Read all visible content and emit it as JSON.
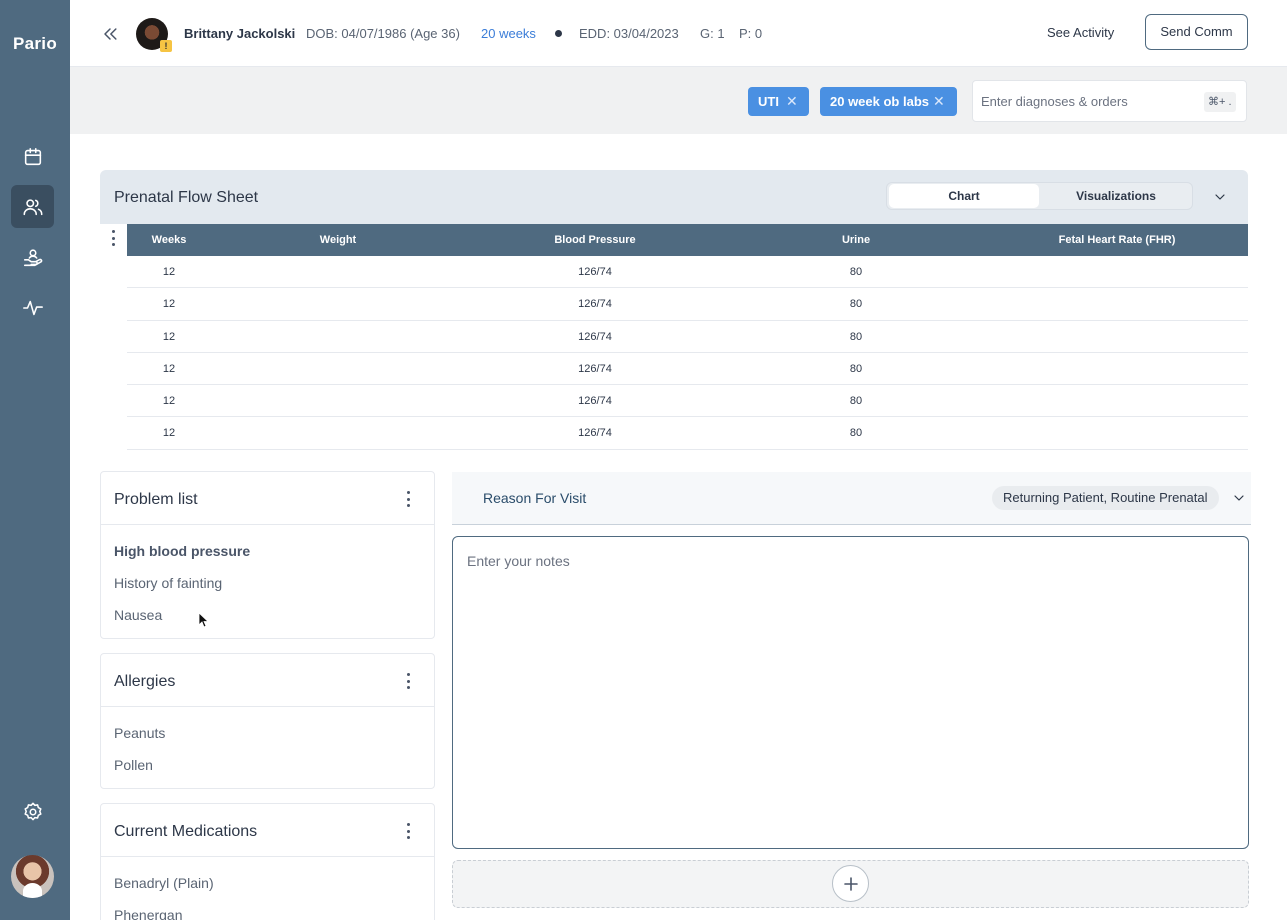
{
  "sidebar": {
    "logo": "Pario",
    "nav": [
      {
        "icon": "calendar-icon",
        "active": false
      },
      {
        "icon": "patients-icon",
        "active": true
      },
      {
        "icon": "care-icon",
        "active": false
      },
      {
        "icon": "activity-icon",
        "active": false
      }
    ],
    "settings_icon": "gear-icon"
  },
  "header": {
    "patient_name": "Brittany Jackolski",
    "dob": "DOB: 04/07/1986 (Age 36)",
    "weeks": "20 weeks",
    "edd": "EDD: 03/04/2023",
    "gravida": "G: 1",
    "para": "P: 0",
    "warning_badge": "!",
    "see_activity": "See Activity",
    "send_comm": "Send Comm"
  },
  "orders": {
    "chips": [
      {
        "label": "UTI",
        "remove": "✕"
      },
      {
        "label": "20 week ob labs",
        "remove": "✕"
      }
    ],
    "placeholder": "Enter diagnoses & orders",
    "shortcut": "⌘+ ."
  },
  "flow_sheet": {
    "title": "Prenatal Flow Sheet",
    "tabs": [
      "Chart",
      "Visualizations"
    ],
    "active_tab": "Chart",
    "columns": [
      "Weeks",
      "Weight",
      "Blood Pressure",
      "Urine",
      "Fetal Heart Rate (FHR)"
    ],
    "rows": [
      [
        "12",
        "",
        "126/74",
        "80",
        ""
      ],
      [
        "12",
        "",
        "126/74",
        "80",
        ""
      ],
      [
        "12",
        "",
        "126/74",
        "80",
        ""
      ],
      [
        "12",
        "",
        "126/74",
        "80",
        ""
      ],
      [
        "12",
        "",
        "126/74",
        "80",
        ""
      ],
      [
        "12",
        "",
        "126/74",
        "80",
        ""
      ]
    ]
  },
  "problem_list": {
    "title": "Problem list",
    "items": [
      "High blood pressure",
      "History of fainting",
      "Nausea"
    ]
  },
  "allergies": {
    "title": "Allergies",
    "items": [
      "Peanuts",
      "Pollen"
    ]
  },
  "medications": {
    "title": "Current Medications",
    "items": [
      "Benadryl (Plain)",
      "Phenergan"
    ]
  },
  "reason_for_visit": {
    "title": "Reason For Visit",
    "value": "Returning Patient, Routine Prenatal",
    "notes_placeholder": "Enter your notes"
  },
  "colors": {
    "sidebar": "#4f6a80",
    "accent": "#4a90e2",
    "link": "#3b7dd8",
    "table_header": "#4f6a80"
  }
}
